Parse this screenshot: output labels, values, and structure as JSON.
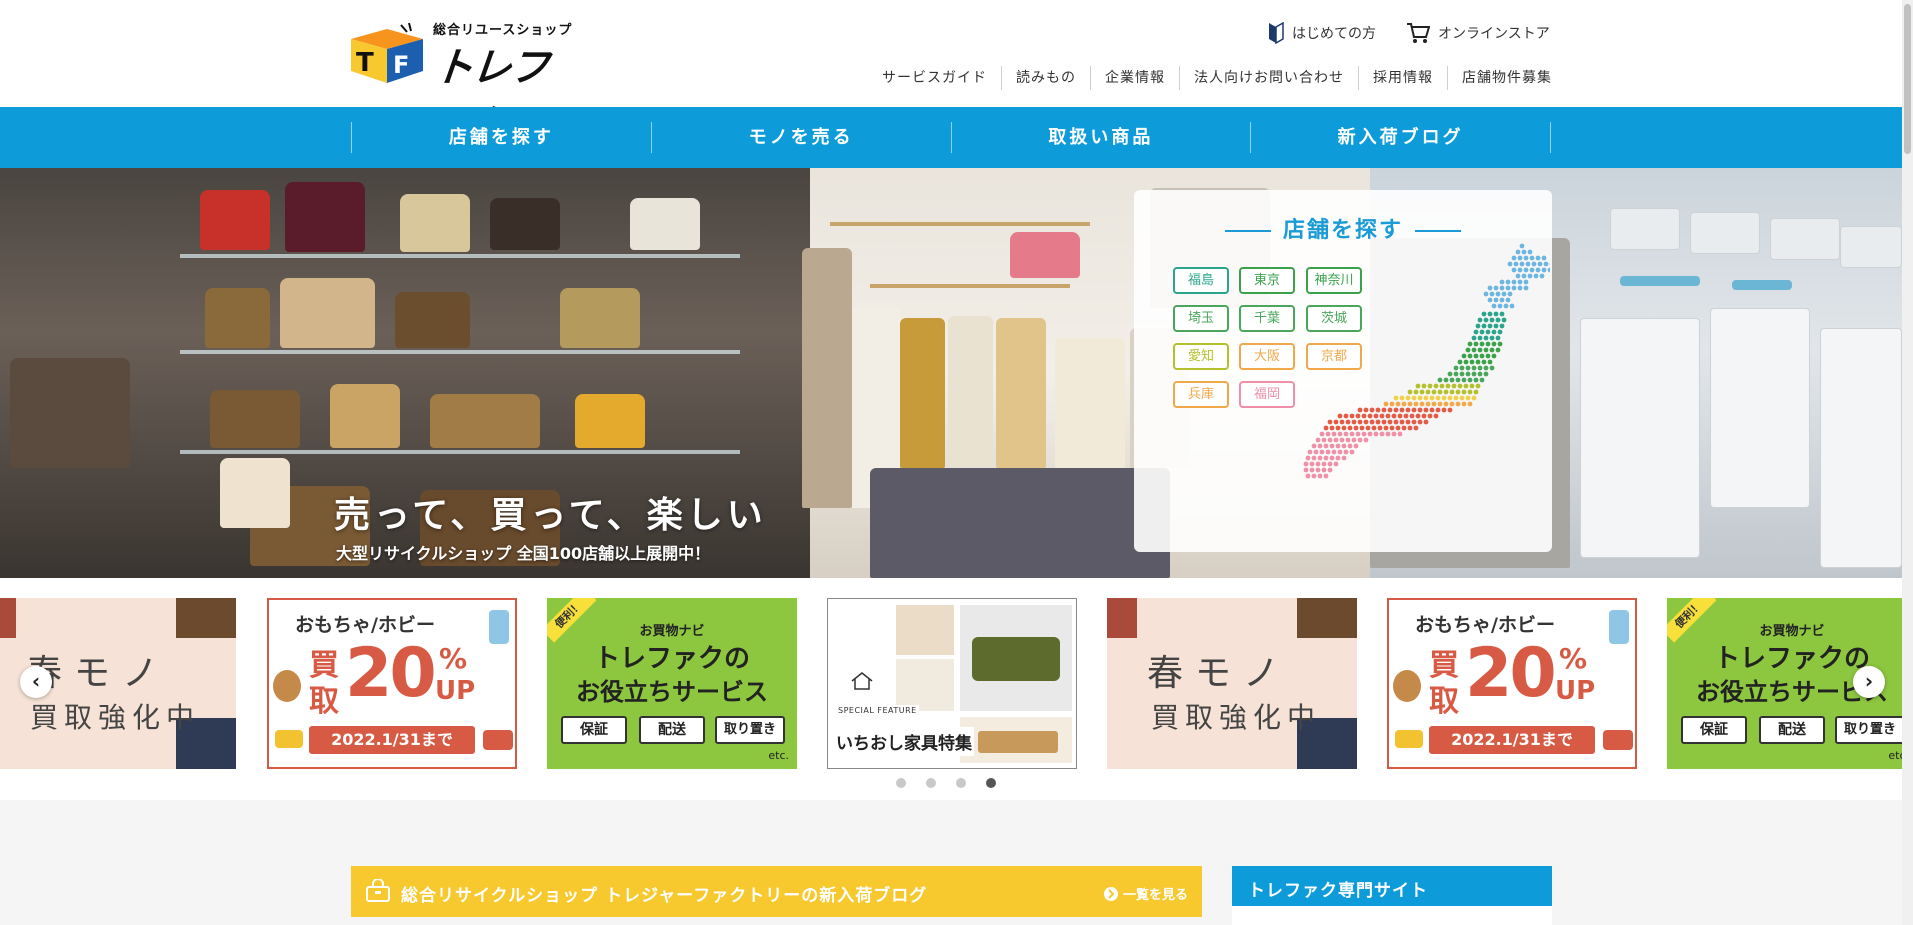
{
  "brand": {
    "tagline": "総合リユースショップ",
    "name": "トレファク",
    "logo_letters": "TF"
  },
  "utility": {
    "first_time": "はじめての方",
    "online_store": "オンラインストア"
  },
  "subnav": [
    "サービスガイド",
    "読みもの",
    "企業情報",
    "法人向けお問い合わせ",
    "採用情報",
    "店舗物件募集"
  ],
  "mainnav": [
    "店舗を探す",
    "モノを売る",
    "取扱い商品",
    "新入荷ブログ"
  ],
  "hero": {
    "title": "売って、買って、楽しい",
    "subtitle": "大型リサイクルショップ 全国100店舗以上展開中！",
    "store_search": {
      "title": "店舗を探す",
      "prefectures": [
        {
          "name": "福島",
          "color": "#2aa58c"
        },
        {
          "name": "東京",
          "color": "#3aa24a"
        },
        {
          "name": "神奈川",
          "color": "#3aa24a"
        },
        {
          "name": "埼玉",
          "color": "#49a65a"
        },
        {
          "name": "千葉",
          "color": "#49a65a"
        },
        {
          "name": "茨城",
          "color": "#49a65a"
        },
        {
          "name": "愛知",
          "color": "#b5c12c"
        },
        {
          "name": "大阪",
          "color": "#f0a84a"
        },
        {
          "name": "京都",
          "color": "#f0a84a"
        },
        {
          "name": "兵庫",
          "color": "#f0a84a"
        },
        {
          "name": "福岡",
          "color": "#f08fa8"
        }
      ]
    }
  },
  "banners": {
    "spring": {
      "line1": "春モノ",
      "line2": "買取強化中"
    },
    "toy": {
      "title": "おもちゃ/ホビー",
      "kanji1": "買",
      "kanji2": "取",
      "number": "20",
      "percent": "%",
      "up": "UP",
      "date": "2022.1/31まで"
    },
    "navi": {
      "ribbon": "便利！",
      "small": "お買物ナビ",
      "line1": "トレファクの",
      "line2": "お役立ちサービス",
      "tags": [
        "保証",
        "配送",
        "取り置き"
      ],
      "etc": "etc."
    },
    "furniture": {
      "label": "SPECIAL FEATURE",
      "title": "いちおし家具特集"
    }
  },
  "carousel": {
    "prev": "‹",
    "next": "›",
    "dots": 4,
    "active_dot": 4
  },
  "lower": {
    "blog_title": "総合リサイクルショップ トレジャーファクトリーの新入荷ブログ",
    "blog_more": "一覧を見る",
    "site_title": "トレファク専門サイト"
  },
  "colors": {
    "primary_blue": "#0d9cd9",
    "blog_yellow": "#f7c92f",
    "banner_red": "#d75a45",
    "banner_green": "#8dc63f"
  }
}
